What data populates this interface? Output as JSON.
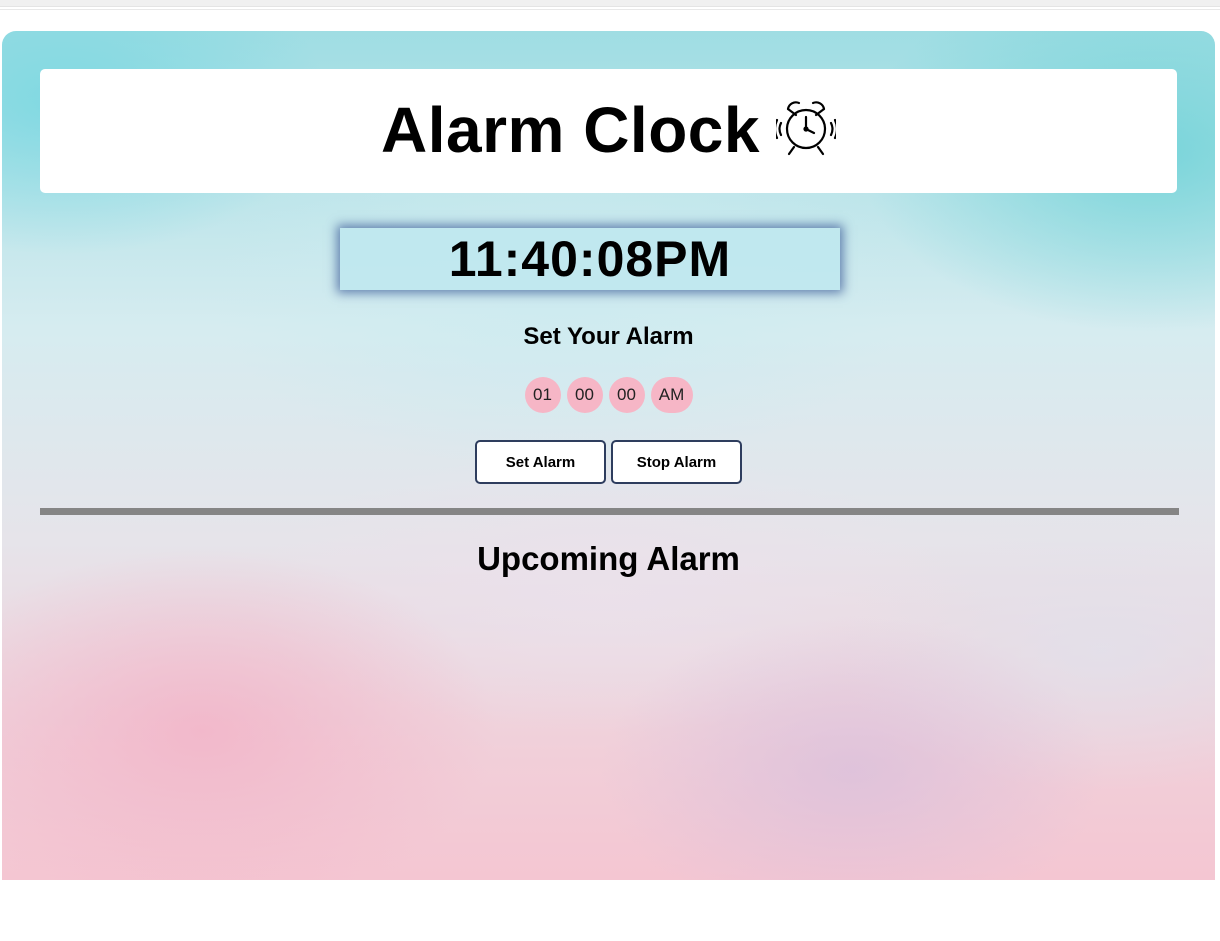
{
  "header": {
    "title": "Alarm Clock",
    "icon": "alarm-clock-icon"
  },
  "clock": {
    "time": "11:40:08PM"
  },
  "alarm_form": {
    "heading": "Set Your Alarm",
    "hour": "01",
    "minute": "00",
    "second": "00",
    "ampm": "AM",
    "set_label": "Set Alarm",
    "stop_label": "Stop Alarm"
  },
  "upcoming": {
    "heading": "Upcoming Alarm"
  },
  "colors": {
    "select_bg": "#f6b6c6",
    "button_border": "#2e3d5e",
    "divider": "#858585",
    "clock_glow": "#28468c"
  }
}
